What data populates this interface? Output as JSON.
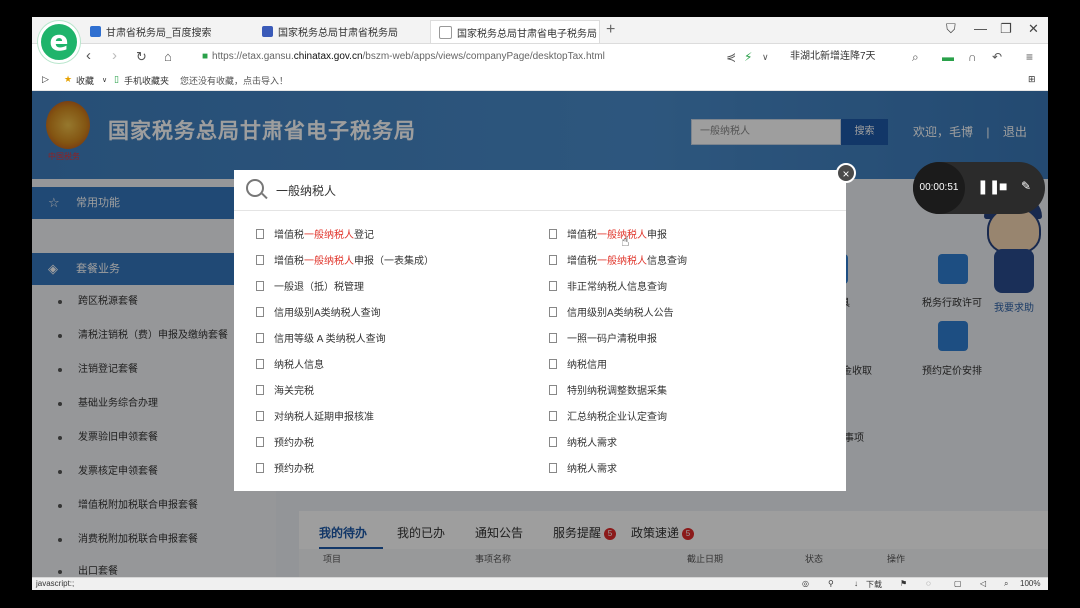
{
  "browser": {
    "tabs": [
      {
        "title": "甘肃省税务局_百度搜索",
        "favicon_color": "#2f6fd0"
      },
      {
        "title": "国家税务总局甘肃省税务局",
        "favicon_color": "#3a5ab8"
      },
      {
        "title": "国家税务总局甘肃省电子税务局",
        "favicon_color": "#cfcfcf"
      }
    ],
    "close_tab": "×",
    "new_tab": "+",
    "url_prefix": "https://etax.gansu.",
    "url_domain": "chinatax.gov.cn",
    "url_path": "/bszm-web/apps/views/companyPage/desktopTax.html",
    "news": "非湖北新增连降7天",
    "bookmarks": {
      "collections": "收藏",
      "mobile": "手机收藏夹",
      "hint": "您还没有收藏，点击导入！"
    }
  },
  "site": {
    "title": "国家税务总局甘肃省电子税务局",
    "emblem_text": "中国税务",
    "search_value": "一般纳税人",
    "search_button": "搜索",
    "welcome": "欢迎，毛博",
    "separator": "|",
    "logout": "退出"
  },
  "sidebar": {
    "common": "常用功能",
    "package": "套餐业务",
    "items": [
      "跨区税源套餐",
      "清税注销税（费）申报及缴纳套餐",
      "注销登记套餐",
      "基础业务综合办理",
      "发票验旧申领套餐",
      "发票核定申领套餐",
      "增值税附加税联合申报套餐",
      "消费税附加税联合申报套餐",
      "出口套餐"
    ]
  },
  "content": {
    "services": [
      "税务行政许可",
      "预约定价安排"
    ],
    "partials": [
      "具",
      "资金收取",
      "事项"
    ],
    "help": "我要求助",
    "tabs": [
      {
        "label": "我的待办",
        "badge": ""
      },
      {
        "label": "我的已办",
        "badge": ""
      },
      {
        "label": "通知公告",
        "badge": ""
      },
      {
        "label": "服务提醒",
        "badge": "5"
      },
      {
        "label": "政策速递",
        "badge": "5"
      }
    ],
    "table_headers": [
      "项目",
      "事项名称",
      "截止日期",
      "状态",
      "操作"
    ]
  },
  "modal": {
    "query": "一般纳税人",
    "close": "×",
    "results_left": [
      {
        "pre": "增值税",
        "hl": "一般纳税人",
        "post": "登记"
      },
      {
        "pre": "增值税",
        "hl": "一般纳税人",
        "post": "申报（一表集成）"
      },
      {
        "pre": "一般退（抵）税管理",
        "hl": "",
        "post": ""
      },
      {
        "pre": "信用级别A类纳税人查询",
        "hl": "",
        "post": ""
      },
      {
        "pre": "信用等级 A 类纳税人查询",
        "hl": "",
        "post": ""
      },
      {
        "pre": "纳税人信息",
        "hl": "",
        "post": ""
      },
      {
        "pre": "海关完税",
        "hl": "",
        "post": ""
      },
      {
        "pre": "对纳税人延期申报核准",
        "hl": "",
        "post": ""
      },
      {
        "pre": "预约办税",
        "hl": "",
        "post": ""
      },
      {
        "pre": "预约办税",
        "hl": "",
        "post": ""
      }
    ],
    "results_right": [
      {
        "pre": "增值税",
        "hl": "一般纳税人",
        "post": "申报"
      },
      {
        "pre": "增值税",
        "hl": "一般纳税人",
        "post": "信息查询"
      },
      {
        "pre": "非正常纳税人信息查询",
        "hl": "",
        "post": ""
      },
      {
        "pre": "信用级别A类纳税人公告",
        "hl": "",
        "post": ""
      },
      {
        "pre": "一照一码户清税申报",
        "hl": "",
        "post": ""
      },
      {
        "pre": "纳税信用",
        "hl": "",
        "post": ""
      },
      {
        "pre": "特别纳税调整数据采集",
        "hl": "",
        "post": ""
      },
      {
        "pre": "汇总纳税企业认定查询",
        "hl": "",
        "post": ""
      },
      {
        "pre": "纳税人需求",
        "hl": "",
        "post": ""
      },
      {
        "pre": "纳税人需求",
        "hl": "",
        "post": ""
      }
    ]
  },
  "recorder": {
    "time": "00:00:51"
  },
  "status": {
    "left": "javascript:;",
    "download": "下载",
    "zoom": "100%"
  }
}
